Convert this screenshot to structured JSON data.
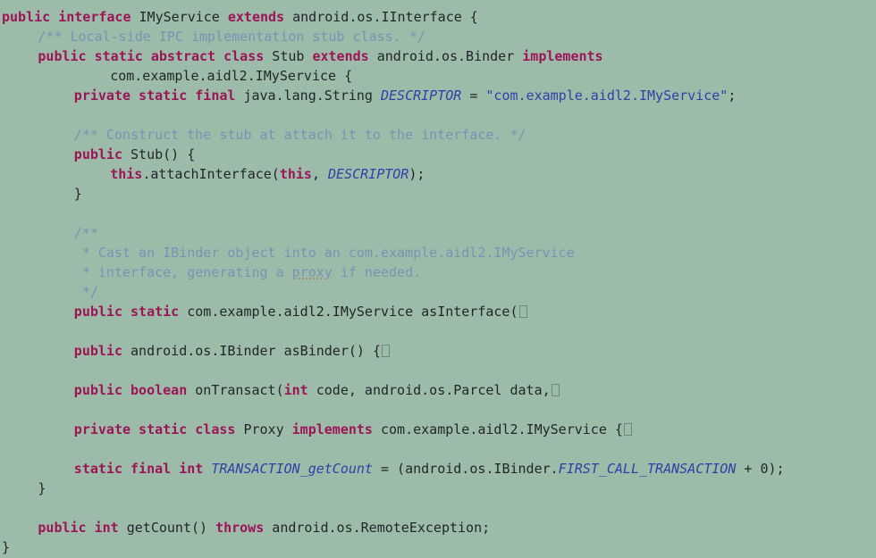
{
  "editor": {
    "language": "java",
    "background_color": "#9CBBA9",
    "keyword_color": "#9B1557",
    "comment_color": "#7C92B4",
    "string_color": "#3140A8",
    "static_field_color": "#3140A8",
    "plain_text_color": "#22262B",
    "font_size_px": 15,
    "line_height_px": 22
  },
  "code": {
    "lines": [
      {
        "index": 1,
        "indent": 0,
        "tokens": [
          {
            "t": "public",
            "c": "kw"
          },
          {
            "t": " ",
            "c": "plain"
          },
          {
            "t": "interface",
            "c": "kw"
          },
          {
            "t": " IMyService ",
            "c": "plain"
          },
          {
            "t": "extends",
            "c": "kw"
          },
          {
            "t": " android.os.IInterface {",
            "c": "plain"
          }
        ]
      },
      {
        "index": 2,
        "indent": 4,
        "tokens": [
          {
            "t": "/** Local-side IPC implementation stub class. */",
            "c": "cmt"
          }
        ]
      },
      {
        "index": 3,
        "indent": 4,
        "tokens": [
          {
            "t": "public",
            "c": "kw"
          },
          {
            "t": " ",
            "c": "plain"
          },
          {
            "t": "static",
            "c": "kw"
          },
          {
            "t": " ",
            "c": "plain"
          },
          {
            "t": "abstract",
            "c": "kw"
          },
          {
            "t": " ",
            "c": "plain"
          },
          {
            "t": "class",
            "c": "kw"
          },
          {
            "t": " Stub ",
            "c": "plain"
          },
          {
            "t": "extends",
            "c": "kw"
          },
          {
            "t": " android.os.Binder ",
            "c": "plain"
          },
          {
            "t": "implements",
            "c": "kw"
          }
        ]
      },
      {
        "index": 4,
        "indent": 12,
        "tokens": [
          {
            "t": "com.example.aidl2.IMyService {",
            "c": "plain"
          }
        ]
      },
      {
        "index": 5,
        "indent": 8,
        "tokens": [
          {
            "t": "private",
            "c": "kw"
          },
          {
            "t": " ",
            "c": "plain"
          },
          {
            "t": "static",
            "c": "kw"
          },
          {
            "t": " ",
            "c": "plain"
          },
          {
            "t": "final",
            "c": "kw"
          },
          {
            "t": " java.lang.String ",
            "c": "plain"
          },
          {
            "t": "DESCRIPTOR",
            "c": "stat"
          },
          {
            "t": " = ",
            "c": "plain"
          },
          {
            "t": "\"com.example.aidl2.IMyService\"",
            "c": "str"
          },
          {
            "t": ";",
            "c": "plain"
          }
        ]
      },
      {
        "index": 6,
        "indent": 0,
        "tokens": []
      },
      {
        "index": 7,
        "indent": 8,
        "tokens": [
          {
            "t": "/** Construct the stub at attach it to the interface. */",
            "c": "cmt"
          }
        ]
      },
      {
        "index": 8,
        "indent": 8,
        "tokens": [
          {
            "t": "public",
            "c": "kw"
          },
          {
            "t": " Stub() {",
            "c": "plain"
          }
        ]
      },
      {
        "index": 9,
        "indent": 12,
        "tokens": [
          {
            "t": "this",
            "c": "kw"
          },
          {
            "t": ".attachInterface(",
            "c": "plain"
          },
          {
            "t": "this",
            "c": "kw"
          },
          {
            "t": ", ",
            "c": "plain"
          },
          {
            "t": "DESCRIPTOR",
            "c": "stat"
          },
          {
            "t": ");",
            "c": "plain"
          }
        ]
      },
      {
        "index": 10,
        "indent": 8,
        "tokens": [
          {
            "t": "}",
            "c": "plain"
          }
        ]
      },
      {
        "index": 11,
        "indent": 0,
        "tokens": []
      },
      {
        "index": 12,
        "indent": 8,
        "tokens": [
          {
            "t": "/**",
            "c": "cmt"
          }
        ]
      },
      {
        "index": 13,
        "indent": 8,
        "tokens": [
          {
            "t": " * Cast an IBinder object into an com.example.aidl2.IMyService",
            "c": "cmt"
          }
        ]
      },
      {
        "index": 14,
        "indent": 8,
        "tokens": [
          {
            "t": " * interface, generating a ",
            "c": "cmt"
          },
          {
            "t": "proxy",
            "c": "cmt typo"
          },
          {
            "t": " if needed.",
            "c": "cmt"
          }
        ]
      },
      {
        "index": 15,
        "indent": 8,
        "tokens": [
          {
            "t": " */",
            "c": "cmt"
          }
        ]
      },
      {
        "index": 16,
        "indent": 8,
        "tokens": [
          {
            "t": "public",
            "c": "kw"
          },
          {
            "t": " ",
            "c": "plain"
          },
          {
            "t": "static",
            "c": "kw"
          },
          {
            "t": " com.example.aidl2.IMyService asInterface(",
            "c": "plain"
          },
          {
            "t": "",
            "c": "fold"
          }
        ]
      },
      {
        "index": 17,
        "indent": 0,
        "tokens": []
      },
      {
        "index": 18,
        "indent": 8,
        "tokens": [
          {
            "t": "public",
            "c": "kw"
          },
          {
            "t": " android.os.IBinder asBinder() {",
            "c": "plain"
          },
          {
            "t": "",
            "c": "fold"
          }
        ]
      },
      {
        "index": 19,
        "indent": 0,
        "tokens": []
      },
      {
        "index": 20,
        "indent": 8,
        "tokens": [
          {
            "t": "public",
            "c": "kw"
          },
          {
            "t": " ",
            "c": "plain"
          },
          {
            "t": "boolean",
            "c": "kw"
          },
          {
            "t": " onTransact(",
            "c": "plain"
          },
          {
            "t": "int",
            "c": "kw"
          },
          {
            "t": " code, android.os.Parcel data,",
            "c": "plain"
          },
          {
            "t": "",
            "c": "fold"
          }
        ]
      },
      {
        "index": 21,
        "indent": 0,
        "tokens": []
      },
      {
        "index": 22,
        "indent": 8,
        "tokens": [
          {
            "t": "private",
            "c": "kw"
          },
          {
            "t": " ",
            "c": "plain"
          },
          {
            "t": "static",
            "c": "kw"
          },
          {
            "t": " ",
            "c": "plain"
          },
          {
            "t": "class",
            "c": "kw"
          },
          {
            "t": " Proxy ",
            "c": "plain"
          },
          {
            "t": "implements",
            "c": "kw"
          },
          {
            "t": " com.example.aidl2.IMyService {",
            "c": "plain"
          },
          {
            "t": "",
            "c": "fold"
          }
        ]
      },
      {
        "index": 23,
        "indent": 0,
        "tokens": []
      },
      {
        "index": 24,
        "indent": 8,
        "tokens": [
          {
            "t": "static",
            "c": "kw"
          },
          {
            "t": " ",
            "c": "plain"
          },
          {
            "t": "final",
            "c": "kw"
          },
          {
            "t": " ",
            "c": "plain"
          },
          {
            "t": "int",
            "c": "kw"
          },
          {
            "t": " ",
            "c": "plain"
          },
          {
            "t": "TRANSACTION_getCount",
            "c": "stat"
          },
          {
            "t": " = (android.os.IBinder.",
            "c": "plain"
          },
          {
            "t": "FIRST_CALL_TRANSACTION",
            "c": "stat"
          },
          {
            "t": " + 0);",
            "c": "plain"
          }
        ]
      },
      {
        "index": 25,
        "indent": 4,
        "tokens": [
          {
            "t": "}",
            "c": "plain"
          }
        ]
      },
      {
        "index": 26,
        "indent": 0,
        "tokens": []
      },
      {
        "index": 27,
        "indent": 4,
        "tokens": [
          {
            "t": "public",
            "c": "kw"
          },
          {
            "t": " ",
            "c": "plain"
          },
          {
            "t": "int",
            "c": "kw"
          },
          {
            "t": " getCount() ",
            "c": "plain"
          },
          {
            "t": "throws",
            "c": "kw"
          },
          {
            "t": " android.os.RemoteException;",
            "c": "plain"
          }
        ]
      },
      {
        "index": 28,
        "indent": 0,
        "tokens": [
          {
            "t": "}",
            "c": "plain"
          }
        ]
      }
    ]
  }
}
